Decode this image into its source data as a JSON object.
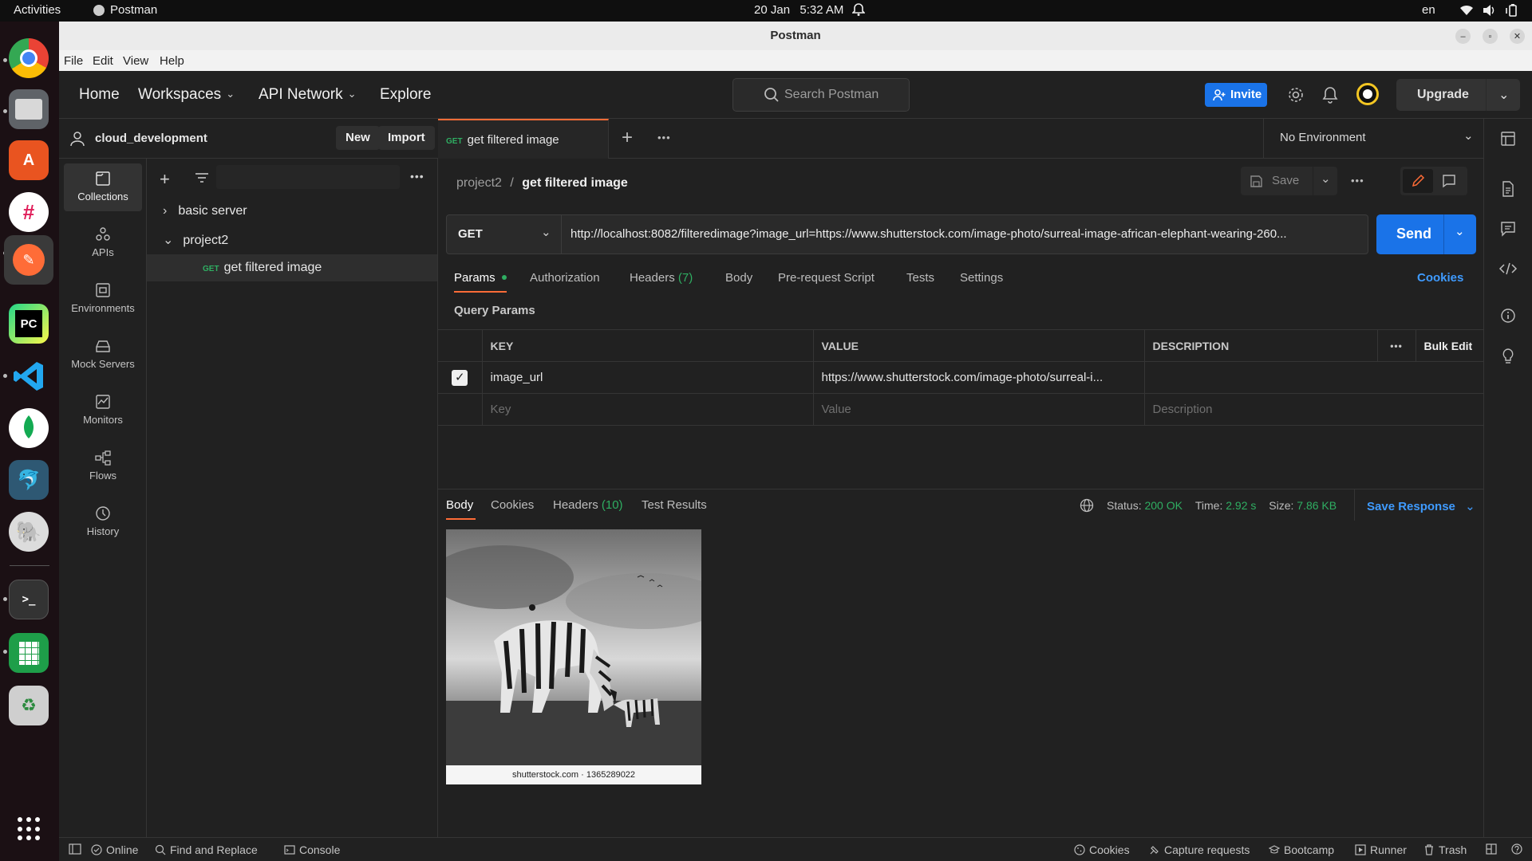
{
  "system_bar": {
    "activities": "Activities",
    "app_name": "Postman",
    "date": "20 Jan",
    "time": "5:32 AM",
    "lang": "en"
  },
  "window": {
    "title": "Postman",
    "menu": [
      "File",
      "Edit",
      "View",
      "Help"
    ]
  },
  "header": {
    "nav": [
      {
        "label": "Home",
        "has_dropdown": false
      },
      {
        "label": "Workspaces",
        "has_dropdown": true
      },
      {
        "label": "API Network",
        "has_dropdown": true
      },
      {
        "label": "Explore",
        "has_dropdown": false
      }
    ],
    "search_placeholder": "Search Postman",
    "invite_label": "Invite",
    "upgrade_label": "Upgrade",
    "accent": "#1a73e8"
  },
  "workspace": {
    "name": "cloud_development",
    "new_label": "New",
    "import_label": "Import"
  },
  "left_nav": [
    {
      "label": "Collections",
      "icon": "collections-icon",
      "active": true
    },
    {
      "label": "APIs",
      "icon": "apis-icon",
      "active": false
    },
    {
      "label": "Environments",
      "icon": "environments-icon",
      "active": false
    },
    {
      "label": "Mock Servers",
      "icon": "mock-servers-icon",
      "active": false
    },
    {
      "label": "Monitors",
      "icon": "monitors-icon",
      "active": false
    },
    {
      "label": "Flows",
      "icon": "flows-icon",
      "active": false
    },
    {
      "label": "History",
      "icon": "history-icon",
      "active": false
    }
  ],
  "collections": {
    "items": [
      {
        "name": "basic server",
        "expanded": false
      },
      {
        "name": "project2",
        "expanded": true
      }
    ],
    "request": {
      "method": "GET",
      "name": "get filtered image"
    }
  },
  "tabs": {
    "open": [
      {
        "method": "GET",
        "name": "get filtered image",
        "accent": "#ff6c37"
      }
    ],
    "environment": "No Environment"
  },
  "request": {
    "breadcrumb_parent": "project2",
    "breadcrumb_sep": "/",
    "breadcrumb_current": "get filtered image",
    "save_label": "Save",
    "method": "GET",
    "url": "http://localhost:8082/filteredimage?image_url=https://www.shutterstock.com/image-photo/surreal-image-african-elephant-wearing-260...",
    "send_label": "Send",
    "tabs": {
      "params": "Params",
      "authorization": "Authorization",
      "headers": "Headers",
      "headers_count": "(7)",
      "body": "Body",
      "prerequest": "Pre-request Script",
      "tests": "Tests",
      "settings": "Settings",
      "cookies": "Cookies"
    },
    "query_params_title": "Query Params",
    "table": {
      "key_header": "KEY",
      "value_header": "VALUE",
      "description_header": "DESCRIPTION",
      "bulk_edit": "Bulk Edit",
      "rows": [
        {
          "checked": true,
          "key": "image_url",
          "value": "https://www.shutterstock.com/image-photo/surreal-i...",
          "description": ""
        }
      ],
      "placeholder": {
        "key": "Key",
        "value": "Value",
        "description": "Description"
      }
    }
  },
  "response": {
    "tabs": {
      "body": "Body",
      "cookies": "Cookies",
      "headers": "Headers",
      "headers_count": "(10)",
      "test_results": "Test Results"
    },
    "status_label": "Status:",
    "status_value": "200 OK",
    "time_label": "Time:",
    "time_value": "2.92 s",
    "size_label": "Size:",
    "size_value": "7.86 KB",
    "save_response": "Save Response",
    "image_caption": "shutterstock.com · 1365289022",
    "status_color": "#2fae62"
  },
  "statusbar": {
    "online": "Online",
    "find_replace": "Find and Replace",
    "console": "Console",
    "cookies": "Cookies",
    "capture": "Capture requests",
    "bootcamp": "Bootcamp",
    "runner": "Runner",
    "trash": "Trash"
  }
}
